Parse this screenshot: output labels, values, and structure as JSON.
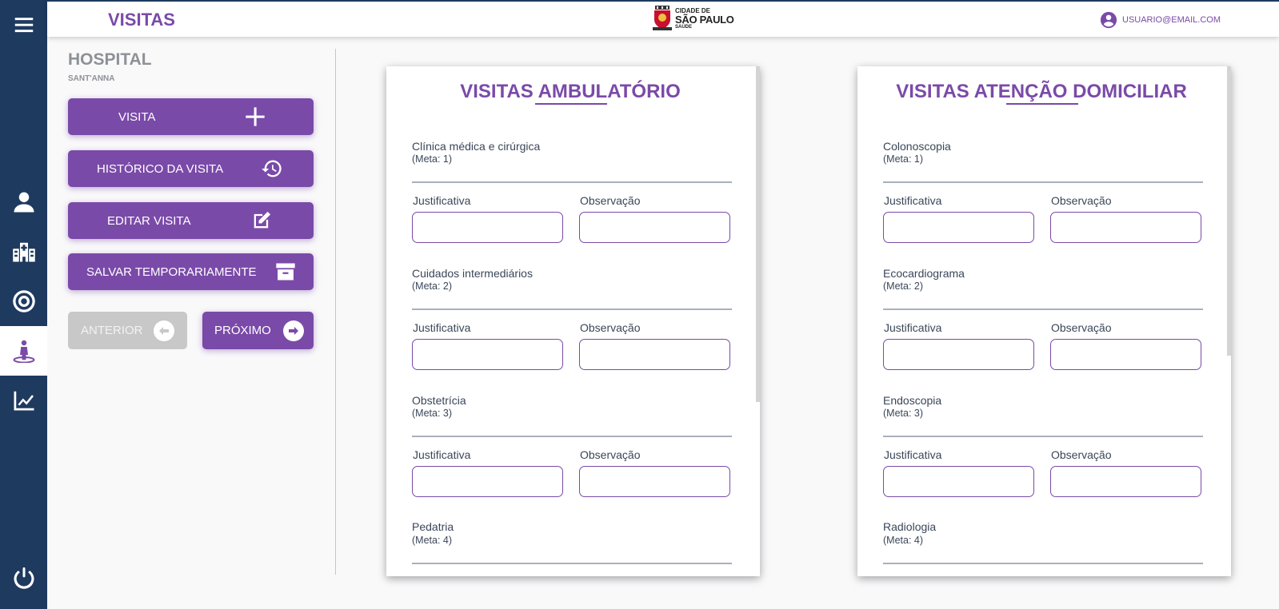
{
  "header": {
    "title": "VISITAS",
    "logo": {
      "line1": "CIDADE DE",
      "line2": "SÃO PAULO",
      "line3": "SAÚDE"
    },
    "user_email": "USUARIO@EMAIL.COM"
  },
  "rail": {
    "items": [
      "menu-icon",
      "user-icon",
      "hospital-icon",
      "target-icon",
      "visit-icon",
      "chart-line-icon",
      "power-icon"
    ],
    "active": "visit-icon"
  },
  "hospital": {
    "name": "HOSPITAL",
    "sub": "SANT'ANNA"
  },
  "actions": {
    "visita": "VISITA",
    "historico": "HISTÓRICO DA VISITA",
    "editar": "EDITAR VISITA",
    "salvar": "SALVAR TEMPORARIAMENTE",
    "anterior": "ANTERIOR",
    "proximo": "PRÓXIMO"
  },
  "fields": {
    "justificativa": "Justificativa",
    "observacao": "Observação"
  },
  "cards": [
    {
      "title": "VISITAS AMBULATÓRIO",
      "items": [
        {
          "name": "Clínica médica e cirúrgica",
          "meta": "(Meta: 1)"
        },
        {
          "name": "Cuidados intermediários",
          "meta": "(Meta: 2)"
        },
        {
          "name": "Obstetrícia",
          "meta": "(Meta: 3)"
        },
        {
          "name": "Pedatria",
          "meta": "(Meta: 4)"
        }
      ]
    },
    {
      "title": "VISITAS ATENÇÃO DOMICILIAR",
      "items": [
        {
          "name": "Colonoscopia",
          "meta": "(Meta: 1)"
        },
        {
          "name": "Ecocardiograma",
          "meta": "(Meta: 2)"
        },
        {
          "name": "Endoscopia",
          "meta": "(Meta: 3)"
        },
        {
          "name": "Radiologia",
          "meta": "(Meta: 4)"
        }
      ]
    }
  ],
  "colors": {
    "accent": "#7a4aa8",
    "rail": "#1f3a5f",
    "disabled": "#c8c8c8"
  }
}
